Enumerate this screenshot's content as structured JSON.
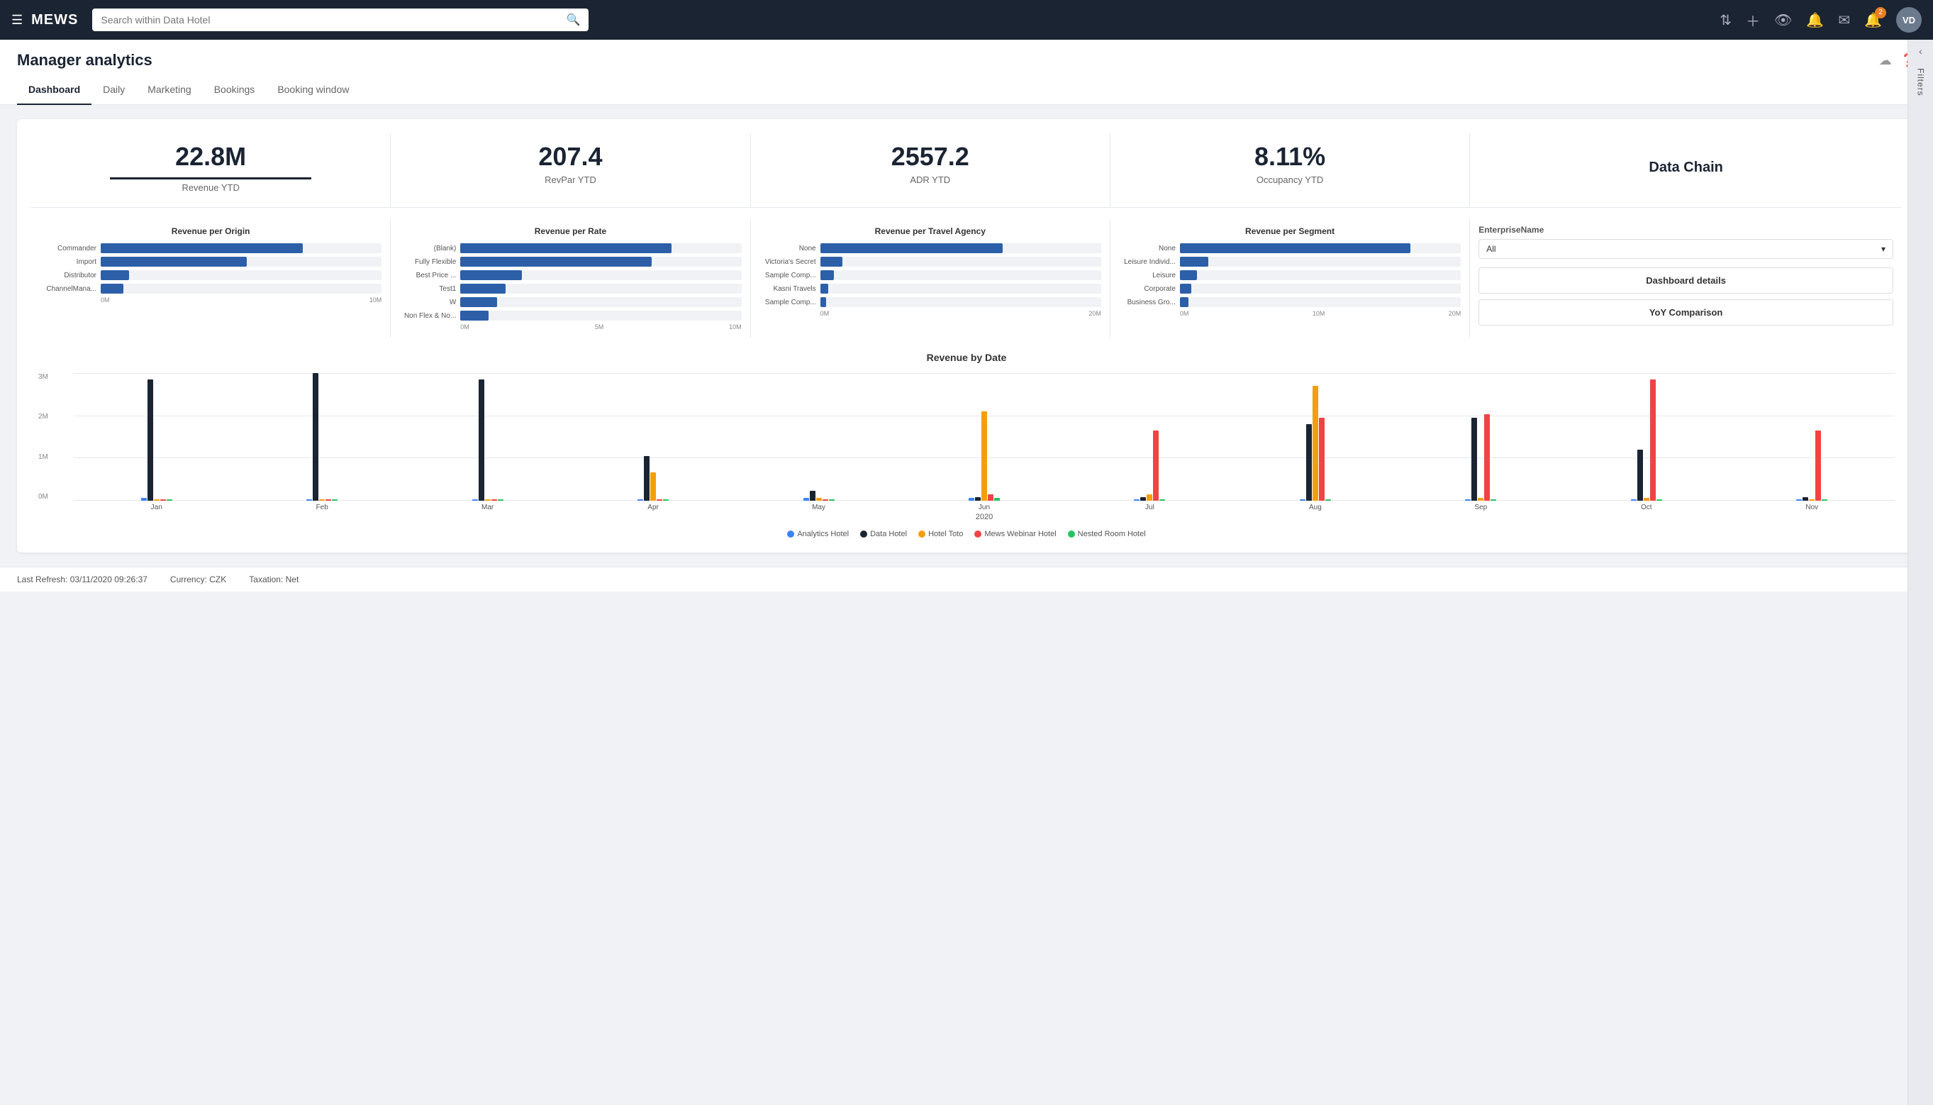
{
  "header": {
    "menu_icon": "☰",
    "logo": "MEWS",
    "search_placeholder": "Search within Data Hotel",
    "icons": [
      "⇅",
      "+",
      "👁",
      "🔔",
      "✉"
    ],
    "badge_count": "2",
    "avatar_initials": "VD"
  },
  "page": {
    "title": "Manager analytics",
    "tabs": [
      "Dashboard",
      "Daily",
      "Marketing",
      "Bookings",
      "Booking window"
    ],
    "active_tab": 0
  },
  "kpis": [
    {
      "value": "22.8M",
      "label": "Revenue YTD",
      "underline": true
    },
    {
      "value": "207.4",
      "label": "RevPar YTD",
      "underline": false
    },
    {
      "value": "2557.2",
      "label": "ADR YTD",
      "underline": false
    },
    {
      "value": "8.11%",
      "label": "Occupancy YTD",
      "underline": false
    },
    {
      "value": "Data Chain",
      "label": ""
    }
  ],
  "charts": {
    "revenue_per_origin": {
      "title": "Revenue per Origin",
      "bars": [
        {
          "label": "Commander",
          "pct": 72
        },
        {
          "label": "Import",
          "pct": 52
        },
        {
          "label": "Distributor",
          "pct": 10
        },
        {
          "label": "ChannelMana...",
          "pct": 8
        }
      ],
      "axis": [
        "0M",
        "10M"
      ]
    },
    "revenue_per_rate": {
      "title": "Revenue per Rate",
      "bars": [
        {
          "label": "(Blank)",
          "pct": 75
        },
        {
          "label": "Fully Flexible",
          "pct": 70
        },
        {
          "label": "Best Price ...",
          "pct": 25
        },
        {
          "label": "Test1",
          "pct": 18
        },
        {
          "label": "W",
          "pct": 15
        },
        {
          "label": "Non Flex & No...",
          "pct": 12
        }
      ],
      "axis": [
        "0M",
        "5M",
        "10M"
      ]
    },
    "revenue_per_agency": {
      "title": "Revenue per Travel Agency",
      "bars": [
        {
          "label": "None",
          "pct": 65
        },
        {
          "label": "Victoria's Secret",
          "pct": 8
        },
        {
          "label": "Sample Comp...",
          "pct": 5
        },
        {
          "label": "Kasni Travels",
          "pct": 3
        },
        {
          "label": "Sample Comp...",
          "pct": 2
        }
      ],
      "axis": [
        "0M",
        "20M"
      ]
    },
    "revenue_per_segment": {
      "title": "Revenue per Segment",
      "bars": [
        {
          "label": "None",
          "pct": 82
        },
        {
          "label": "Leisure Individ...",
          "pct": 10
        },
        {
          "label": "Leisure",
          "pct": 6
        },
        {
          "label": "Corporate",
          "pct": 4
        },
        {
          "label": "Business Gro...",
          "pct": 3
        }
      ],
      "axis": [
        "0M",
        "10M",
        "20M"
      ]
    }
  },
  "enterprise": {
    "label": "EnterpriseName",
    "select_value": "All",
    "buttons": [
      "Dashboard details",
      "YoY Comparison"
    ]
  },
  "revenue_by_date": {
    "title": "Revenue by Date",
    "year": "2020",
    "y_labels": [
      "3M",
      "2M",
      "1M",
      "0M"
    ],
    "months": [
      "Jan",
      "Feb",
      "Mar",
      "Apr",
      "May",
      "Jun",
      "Jul",
      "Aug",
      "Sep",
      "Oct",
      "Nov"
    ],
    "legend": [
      {
        "name": "Analytics Hotel",
        "color": "#3b82f6"
      },
      {
        "name": "Data Hotel",
        "color": "#1a2433"
      },
      {
        "name": "Hotel Toto",
        "color": "#f59e0b"
      },
      {
        "name": "Mews Webinar Hotel",
        "color": "#ef4444"
      },
      {
        "name": "Nested Room Hotel",
        "color": "#22c55e"
      }
    ],
    "data": {
      "Analytics Hotel": [
        0,
        0,
        0,
        0,
        0.5,
        1,
        0,
        0,
        0,
        0,
        0
      ],
      "Data Hotel": [
        95,
        100,
        95,
        35,
        8,
        2,
        2,
        60,
        65,
        40,
        3
      ],
      "Hotel Toto": [
        0,
        0,
        0,
        22,
        0,
        70,
        5,
        90,
        0,
        0,
        0
      ],
      "Mews Webinar Hotel": [
        0,
        0,
        0,
        0,
        0,
        5,
        55,
        65,
        68,
        95,
        55
      ],
      "Nested Room Hotel": [
        0,
        0,
        0,
        0,
        0,
        2,
        0,
        0,
        0,
        0,
        0
      ]
    }
  },
  "footer": {
    "last_refresh": "Last Refresh: 03/11/2020 09:26:37",
    "currency": "Currency: CZK",
    "taxation": "Taxation: Net"
  },
  "filters": {
    "label": "Filters"
  }
}
